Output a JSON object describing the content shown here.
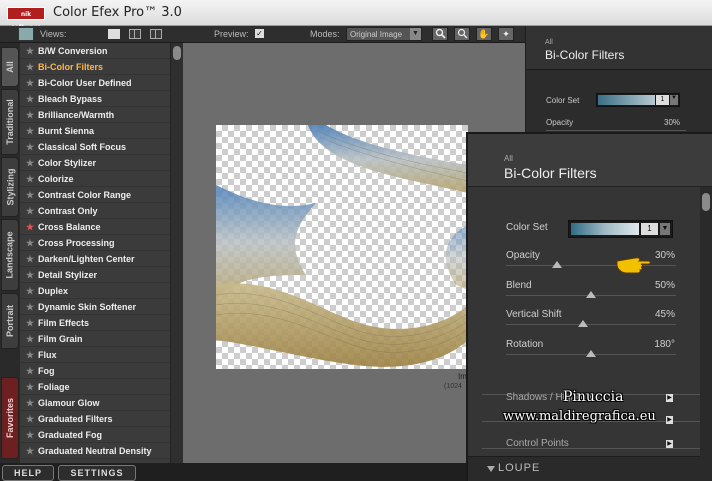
{
  "app": {
    "title": "Color Efex Pro™ 3.0",
    "logo": "nik software"
  },
  "toolbar": {
    "views_label": "Views:",
    "preview_label": "Preview:",
    "preview_checked": "✓",
    "modes_label": "Modes:",
    "mode_value": "Original Image",
    "tools": [
      "zoom-icon",
      "hand-icon",
      "lightbulb-icon"
    ]
  },
  "tabs": [
    "All",
    "Traditional",
    "Stylizing",
    "Landscape",
    "Portrait",
    "Favorites"
  ],
  "filters": [
    "B/W Conversion",
    "Bi-Color Filters",
    "Bi-Color User Defined",
    "Bleach Bypass",
    "Brilliance/Warmth",
    "Burnt Sienna",
    "Classical Soft Focus",
    "Color Stylizer",
    "Colorize",
    "Contrast Color Range",
    "Contrast Only",
    "Cross Balance",
    "Cross Processing",
    "Darken/Lighten Center",
    "Detail Stylizer",
    "Duplex",
    "Dynamic Skin Softener",
    "Film Effects",
    "Film Grain",
    "Flux",
    "Fog",
    "Foliage",
    "Glamour Glow",
    "Graduated Filters",
    "Graduated Fog",
    "Graduated Neutral Density"
  ],
  "selected_filter": "Bi-Color Filters",
  "canvas": {
    "image_label": "Im",
    "image_size": "(1024"
  },
  "right_panel": {
    "category": "All",
    "title": "Bi-Color Filters",
    "color_set_label": "Color Set",
    "color_set_value": "1",
    "opacity_label": "Opacity",
    "opacity_value": "30%"
  },
  "zoom_panel": {
    "category": "All",
    "title": "Bi-Color Filters",
    "color_set_label": "Color Set",
    "color_set_value": "1",
    "sliders": [
      {
        "label": "Opacity",
        "value": "30%",
        "level": 0.3
      },
      {
        "label": "Blend",
        "value": "50%",
        "level": 0.5
      },
      {
        "label": "Vertical Shift",
        "value": "45%",
        "level": 0.45
      },
      {
        "label": "Rotation",
        "value": "180°",
        "level": 0.5
      }
    ],
    "sections": [
      "Shadows / Highlights",
      "",
      "Control Points"
    ],
    "loupe": "LOUPE",
    "watermark_top": "Pinuccia",
    "watermark_bottom": "www.maldiregrafica.eu"
  },
  "bottom": {
    "help": "HELP",
    "settings": "SETTINGS"
  },
  "colors": {
    "selected": "#ffb84d",
    "accent_star": "#e05555",
    "favorites_tab": "#6e1f1f"
  }
}
